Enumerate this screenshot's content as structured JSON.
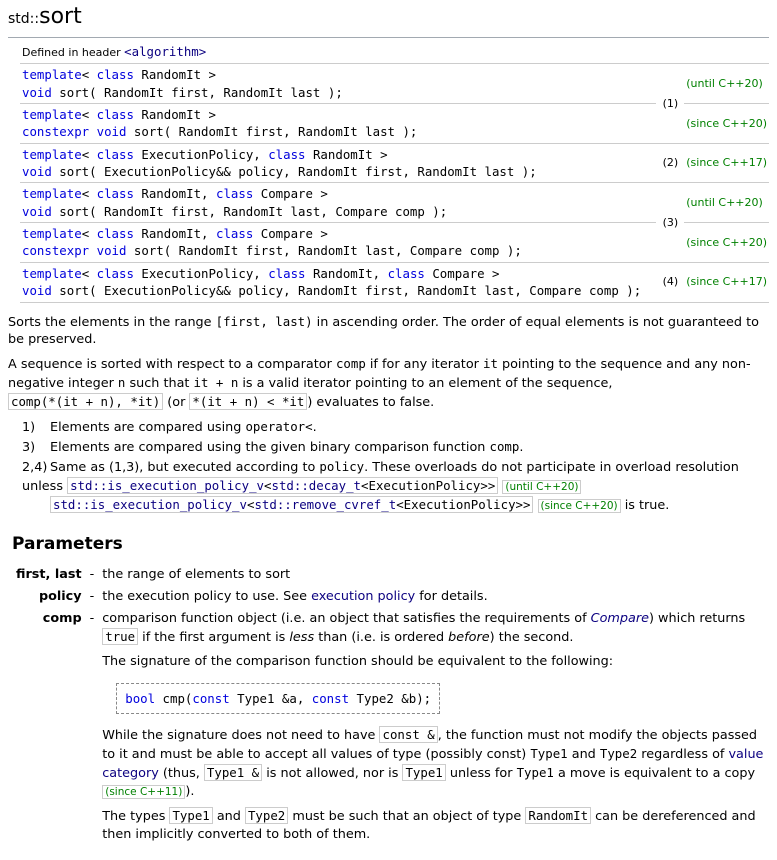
{
  "page": {
    "title_prefix": "std::",
    "title_main": "sort",
    "header_prefix": "Defined in header ",
    "header_link": "<algorithm>"
  },
  "decls": [
    {
      "sig": "template< class RandomIt >\nvoid sort( RandomIt first, RandomIt last );",
      "num": "",
      "mark": "(until C++20)"
    },
    {
      "sig": "template< class RandomIt >\nconstexpr void sort( RandomIt first, RandomIt last );",
      "num": "(1)",
      "mark": "(since C++20)"
    },
    {
      "sig": "template< class ExecutionPolicy, class RandomIt >\nvoid sort( ExecutionPolicy&& policy, RandomIt first, RandomIt last );",
      "num": "(2)",
      "mark": "(since C++17)"
    },
    {
      "sig": "template< class RandomIt, class Compare >\nvoid sort( RandomIt first, RandomIt last, Compare comp );",
      "num": "",
      "mark": "(until C++20)"
    },
    {
      "sig": "template< class RandomIt, class Compare >\nconstexpr void sort( RandomIt first, RandomIt last, Compare comp );",
      "num": "(3)",
      "mark": "(since C++20)"
    },
    {
      "sig": "template< class ExecutionPolicy, class RandomIt, class Compare >\nvoid sort( ExecutionPolicy&& policy, RandomIt first, RandomIt last, Compare comp );",
      "num": "(4)",
      "mark": "(since C++17)"
    }
  ],
  "desc": {
    "p1a": "Sorts the elements in the range ",
    "p1code": "[first, last)",
    "p1b": " in ascending order. The order of equal elements is not guaranteed to be preserved.",
    "p2a": "A sequence is sorted with respect to a comparator ",
    "p2comp": "comp",
    "p2b": " if for any iterator ",
    "p2it": "it",
    "p2c": " pointing to the sequence and any non-negative integer ",
    "p2n": "n",
    "p2d": " such that ",
    "p2itn": "it + n",
    "p2e": " is a valid iterator pointing to an element of the sequence, ",
    "p2code1": "comp(*(it + n), *it)",
    "p2or": " (or ",
    "p2code2": "*(it + n) < *it",
    "p2f": ") evaluates to false.",
    "l1": "Elements are compared using ",
    "l1op": "operator<",
    "l1b": ".",
    "l3": "Elements are compared using the given binary comparison function ",
    "l3comp": "comp",
    "l3b": ".",
    "l24a": "Same as ",
    "l24nums": "(1,3)",
    "l24b": ", but executed according to ",
    "l24pol": "policy",
    "l24c": ". These overloads do not participate in overload resolution unless ",
    "l24code1a": "std::is_execution_policy_v",
    "l24code1b": "std::decay_t",
    "l24code1c": "<ExecutionPolicy>>",
    "l24mark1": "(until C++20)",
    "l24code2a": "std::is_execution_policy_v",
    "l24code2b": "std::remove_cvref_t",
    "l24code2c": "<ExecutionPolicy>>",
    "l24mark2": "(since C++20)",
    "l24d": " is true."
  },
  "sections": {
    "parameters": "Parameters"
  },
  "params": {
    "firstlast": {
      "name": "first, last",
      "dash": "-",
      "desc": "the range of elements to sort"
    },
    "policy": {
      "name": "policy",
      "dash": "-",
      "a": "the execution policy to use. See ",
      "link": "execution policy",
      "b": " for details."
    },
    "comp": {
      "name": "comp",
      "dash": "-",
      "a": "comparison function object (i.e. an object that satisfies the requirements of ",
      "compare": "Compare",
      "b": ") which returns ​",
      "true": "true",
      "c": " if the first argument is ",
      "less": "less",
      "d": " than (i.e. is ordered ",
      "before": "before",
      "e": ") the second.",
      "sigintro": "The signature of the comparison function should be equivalent to the following:",
      "sigcode": " bool cmp(const Type1 &a, const Type2 &b);",
      "p3a": "While the signature does not need to have ",
      "constref": "const &",
      "p3b": ", the function must not modify the objects passed to it and must be able to accept all values of type (possibly const) ",
      "t1": "Type1",
      "and": " and ",
      "t2": "Type2",
      "p3c": " regardless of ",
      "vcat": "value category",
      "p3d": " (thus, ",
      "t1ref": "Type1 &",
      "p3e": " is not allowed, nor is ",
      "t1b": "Type1",
      "p3f": " unless for ",
      "t1c": "Type1",
      "p3g": " a move is equivalent to a copy ",
      "since11": "(since C++11)",
      "p3h": ").",
      "p4a": "The types ",
      "p4t1": "Type1",
      "p4and": " and ",
      "p4t2": "Type2",
      "p4b": " must be such that an object of type ",
      "randit": "RandomIt",
      "p4c": " can be dereferenced and then implicitly converted to both of them."
    }
  }
}
